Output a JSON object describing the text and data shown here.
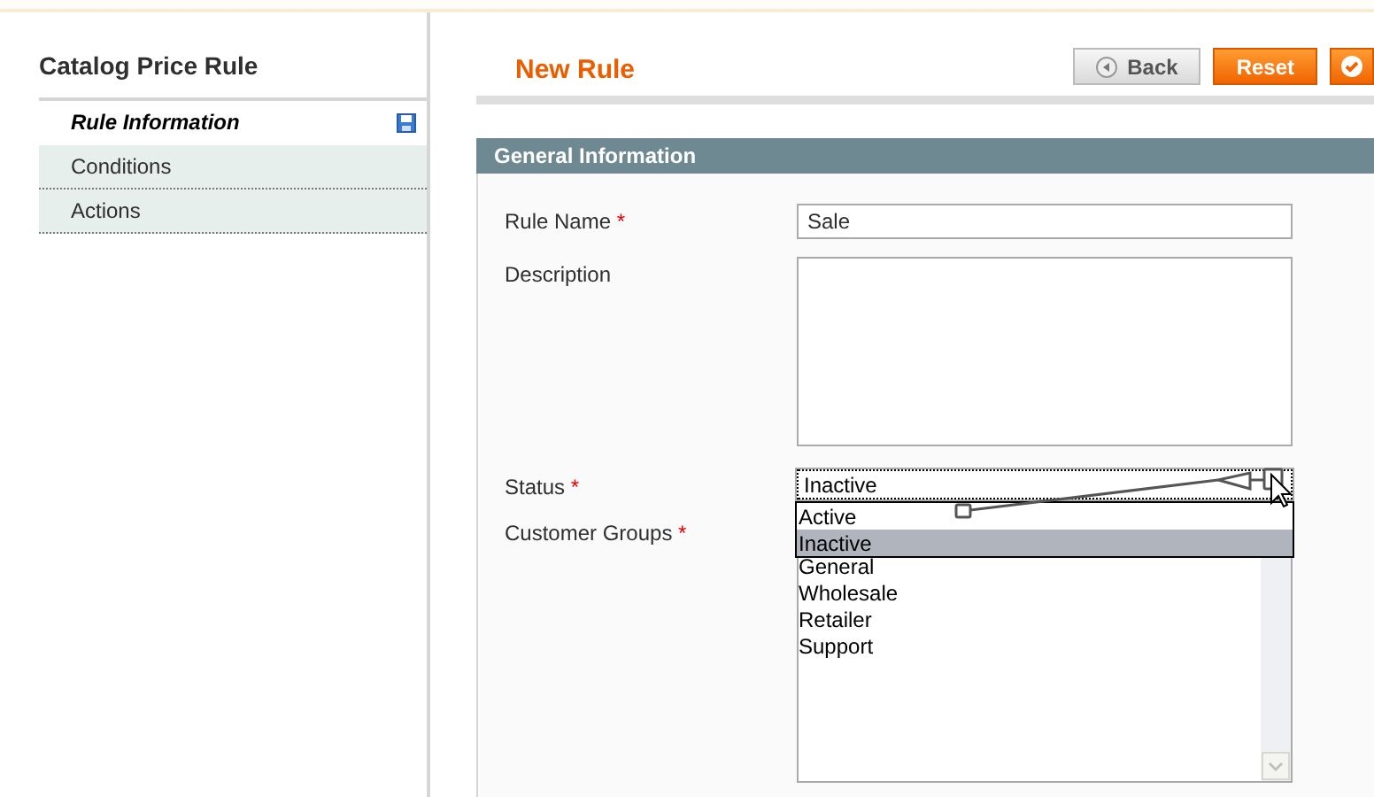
{
  "sidebar": {
    "title": "Catalog Price Rule",
    "tabs": [
      {
        "label": "Rule Information",
        "selected": true,
        "saved": true
      },
      {
        "label": "Conditions",
        "selected": false,
        "saved": false
      },
      {
        "label": "Actions",
        "selected": false,
        "saved": false
      }
    ]
  },
  "page_title": "New Rule",
  "buttons": [
    {
      "kind": "back",
      "label": "Back"
    },
    {
      "kind": "primary",
      "label": "Reset"
    },
    {
      "kind": "save"
    }
  ],
  "section": {
    "title": "General Information",
    "fields": [
      {
        "kind": "text",
        "label": "Rule Name",
        "required_mark": "*",
        "value": "Sale"
      },
      {
        "kind": "textarea",
        "label": "Description"
      },
      {
        "kind": "select",
        "label": "Status",
        "required_mark": "*",
        "value": "Inactive",
        "expanded": true,
        "options": [
          {
            "label": "Active",
            "selected": false
          },
          {
            "label": "Inactive",
            "selected": true
          }
        ]
      },
      {
        "kind": "multiselect",
        "label": "Customer Groups",
        "required_mark": "*",
        "options": [
          {
            "label": "General",
            "selected": false
          },
          {
            "label": "Wholesale",
            "selected": false
          },
          {
            "label": "Retailer",
            "selected": false
          },
          {
            "label": "Support",
            "selected": false
          }
        ]
      }
    ]
  }
}
